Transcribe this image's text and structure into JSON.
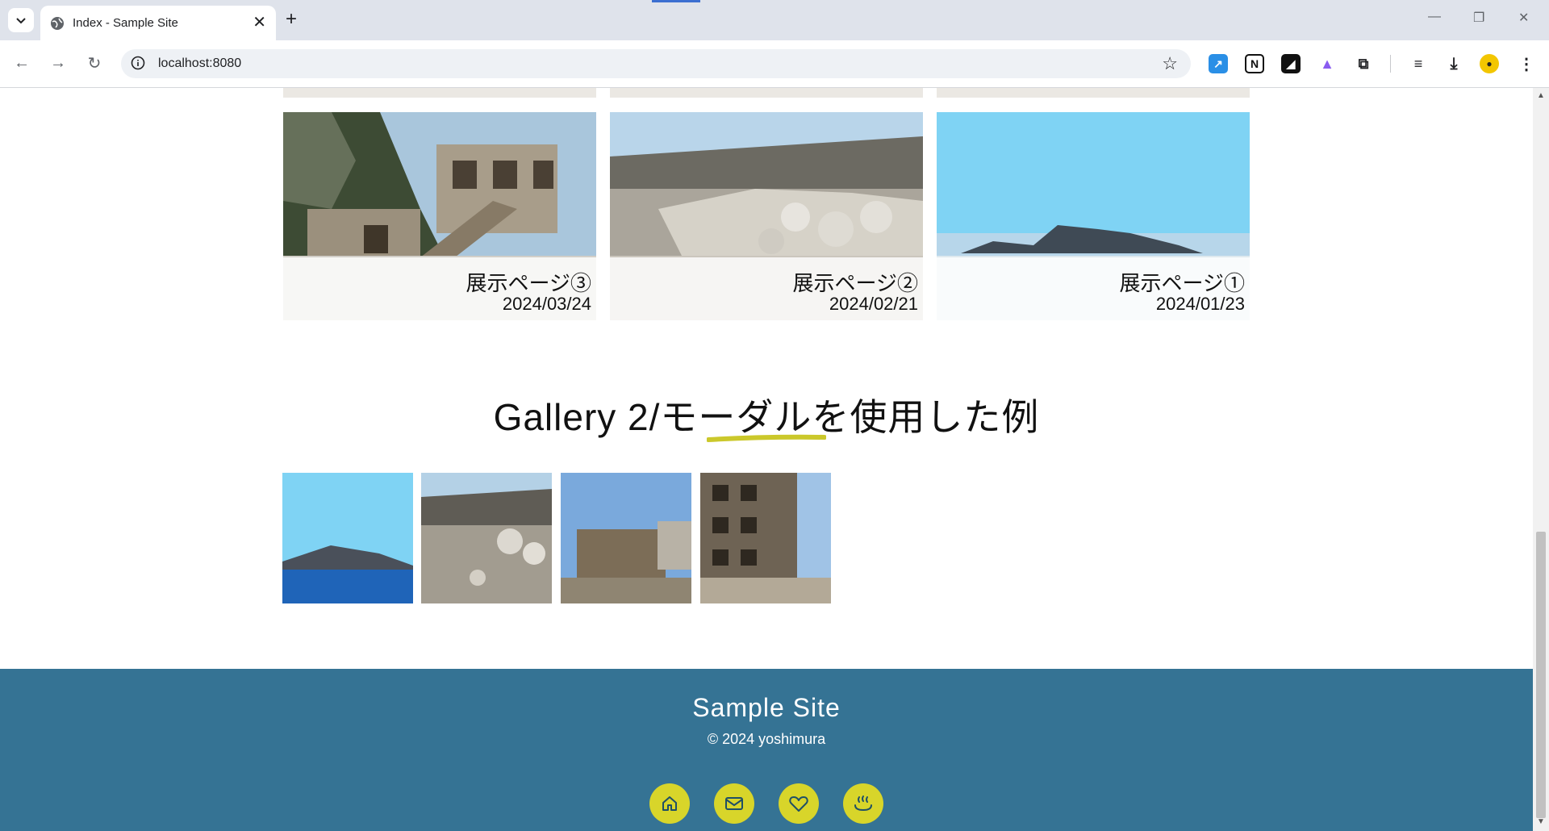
{
  "browser": {
    "tab_title": "Index - Sample Site",
    "url": "localhost:8080"
  },
  "cards": [
    {
      "title": "展示ページ③",
      "date": "2024/03/24"
    },
    {
      "title": "展示ページ②",
      "date": "2024/02/21"
    },
    {
      "title": "展示ページ①",
      "date": "2024/01/23"
    }
  ],
  "gallery2": {
    "heading": "Gallery 2/モーダルを使用した例"
  },
  "footer": {
    "site_name": "Sample Site",
    "copyright": "© 2024 yoshimura",
    "icons": [
      "home-icon",
      "mail-icon",
      "heart-icon",
      "hot-spring-icon"
    ]
  },
  "colors": {
    "footer_bg": "#357394",
    "accent": "#d8d52a"
  }
}
